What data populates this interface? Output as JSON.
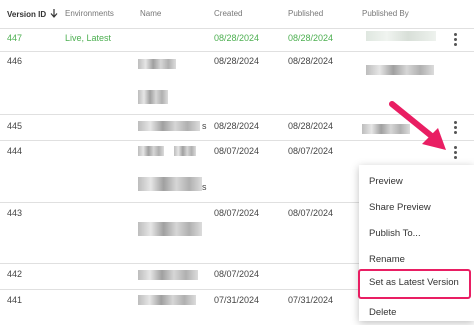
{
  "columns": [
    {
      "label": "Version ID",
      "sort_icon": "arrow-down-icon"
    },
    {
      "label": "Environments"
    },
    {
      "label": "Name"
    },
    {
      "label": "Created"
    },
    {
      "label": "Published"
    },
    {
      "label": "Published By"
    }
  ],
  "rows": [
    {
      "version": "447",
      "env": "Live, Latest",
      "created": "08/28/2024",
      "published": "08/28/2024"
    },
    {
      "version": "446",
      "env": "",
      "created": "08/28/2024",
      "published": "08/28/2024"
    },
    {
      "version": "445",
      "env": "",
      "name_suffix": "s",
      "created": "08/28/2024",
      "published": "08/28/2024"
    },
    {
      "version": "444",
      "env": "",
      "name_suffix": "s",
      "created": "08/07/2024",
      "published": "08/07/2024"
    },
    {
      "version": "443",
      "env": "",
      "created": "08/07/2024",
      "published": "08/07/2024"
    },
    {
      "version": "442",
      "env": "",
      "created": "08/07/2024",
      "published": ""
    },
    {
      "version": "441",
      "env": "",
      "created": "07/31/2024",
      "published": "07/31/2024"
    }
  ],
  "menu": {
    "items": [
      "Preview",
      "Share Preview",
      "Publish To...",
      "Rename",
      "Set as Latest Version",
      "Delete"
    ],
    "highlighted": "Set as Latest Version"
  },
  "colors": {
    "live": "#4caf50",
    "highlight": "#e91e63"
  }
}
